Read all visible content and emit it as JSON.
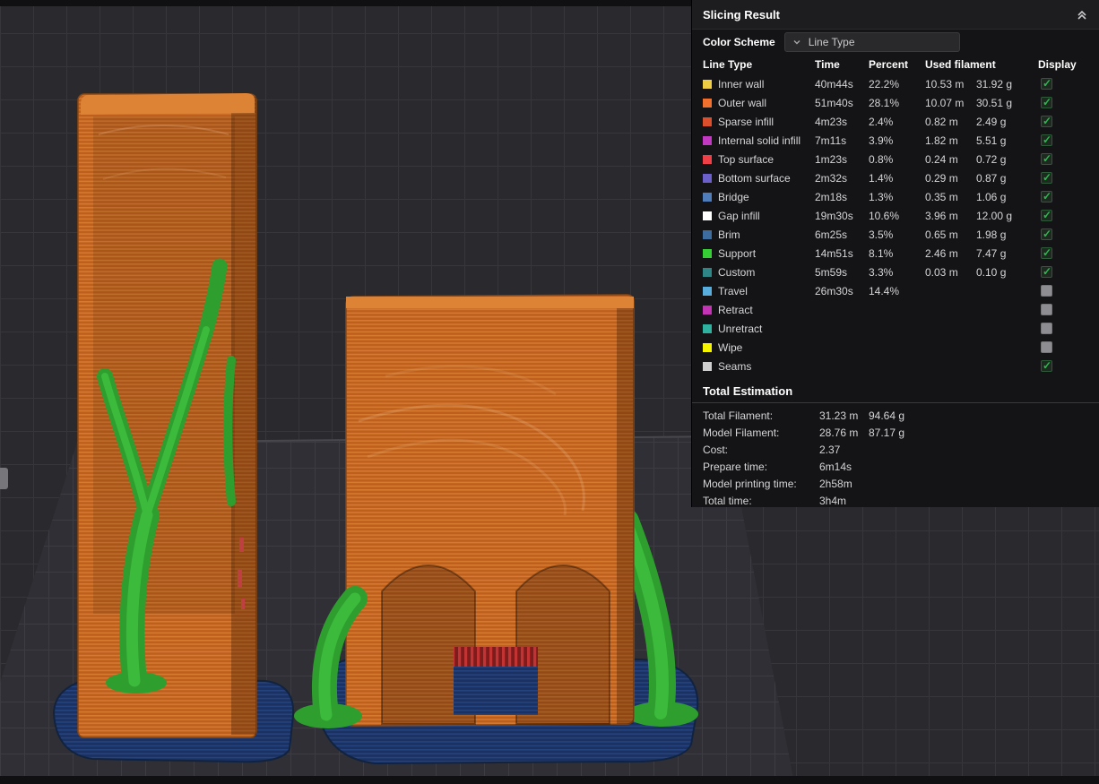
{
  "panel": {
    "title": "Slicing Result",
    "color_scheme": {
      "label": "Color Scheme",
      "value": "Line Type"
    },
    "columns": [
      "Line Type",
      "Time",
      "Percent",
      "Used filament",
      "Display"
    ],
    "rows": [
      {
        "label": "Inner wall",
        "color": "#EFCE43",
        "time": "40m44s",
        "percent": "22.2%",
        "length": "10.53 m",
        "weight": "31.92 g",
        "display": true
      },
      {
        "label": "Outer wall",
        "color": "#F2702E",
        "time": "51m40s",
        "percent": "28.1%",
        "length": "10.07 m",
        "weight": "30.51 g",
        "display": true
      },
      {
        "label": "Sparse infill",
        "color": "#DB4F2C",
        "time": "4m23s",
        "percent": "2.4%",
        "length": "0.82 m",
        "weight": "2.49 g",
        "display": true
      },
      {
        "label": "Internal solid infill",
        "color": "#C138C1",
        "time": "7m11s",
        "percent": "3.9%",
        "length": "1.82 m",
        "weight": "5.51 g",
        "display": true
      },
      {
        "label": "Top surface",
        "color": "#EF4048",
        "time": "1m23s",
        "percent": "0.8%",
        "length": "0.24 m",
        "weight": "0.72 g",
        "display": true
      },
      {
        "label": "Bottom surface",
        "color": "#6B5FC9",
        "time": "2m32s",
        "percent": "1.4%",
        "length": "0.29 m",
        "weight": "0.87 g",
        "display": true
      },
      {
        "label": "Bridge",
        "color": "#4E7DBA",
        "time": "2m18s",
        "percent": "1.3%",
        "length": "0.35 m",
        "weight": "1.06 g",
        "display": true
      },
      {
        "label": "Gap infill",
        "color": "#FFFFFF",
        "time": "19m30s",
        "percent": "10.6%",
        "length": "3.96 m",
        "weight": "12.00 g",
        "display": true
      },
      {
        "label": "Brim",
        "color": "#3D6D9E",
        "time": "6m25s",
        "percent": "3.5%",
        "length": "0.65 m",
        "weight": "1.98 g",
        "display": true
      },
      {
        "label": "Support",
        "color": "#35CE35",
        "time": "14m51s",
        "percent": "8.1%",
        "length": "2.46 m",
        "weight": "7.47 g",
        "display": true
      },
      {
        "label": "Custom",
        "color": "#2E8686",
        "time": "5m59s",
        "percent": "3.3%",
        "length": "0.03 m",
        "weight": "0.10 g",
        "display": true
      },
      {
        "label": "Travel",
        "color": "#57AEDC",
        "time": "26m30s",
        "percent": "14.4%",
        "length": "",
        "weight": "",
        "display": false
      },
      {
        "label": "Retract",
        "color": "#C234B4",
        "time": "",
        "percent": "",
        "length": "",
        "weight": "",
        "display": false
      },
      {
        "label": "Unretract",
        "color": "#2FB1A0",
        "time": "",
        "percent": "",
        "length": "",
        "weight": "",
        "display": false
      },
      {
        "label": "Wipe",
        "color": "#F5F500",
        "time": "",
        "percent": "",
        "length": "",
        "weight": "",
        "display": false
      },
      {
        "label": "Seams",
        "color": "#CFCFCF",
        "time": "",
        "percent": "",
        "length": "",
        "weight": "",
        "display": true
      }
    ],
    "total_estimation": {
      "title": "Total Estimation",
      "items": [
        {
          "label": "Total Filament:",
          "v1": "31.23 m",
          "v2": "94.64 g"
        },
        {
          "label": "Model Filament:",
          "v1": "28.76 m",
          "v2": "87.17 g"
        },
        {
          "label": "Cost:",
          "v1": "2.37",
          "v2": ""
        },
        {
          "label": "Prepare time:",
          "v1": "6m14s",
          "v2": ""
        },
        {
          "label": "Model printing time:",
          "v1": "2h58m",
          "v2": ""
        },
        {
          "label": "Total time:",
          "v1": "3h4m",
          "v2": ""
        }
      ]
    }
  },
  "scene": {
    "colors": {
      "background": "#2A2A2E",
      "model_orange": "#C96A26",
      "support_green": "#35B435",
      "brim_blue": "#1D3869",
      "infill_red": "#BF4040"
    }
  }
}
